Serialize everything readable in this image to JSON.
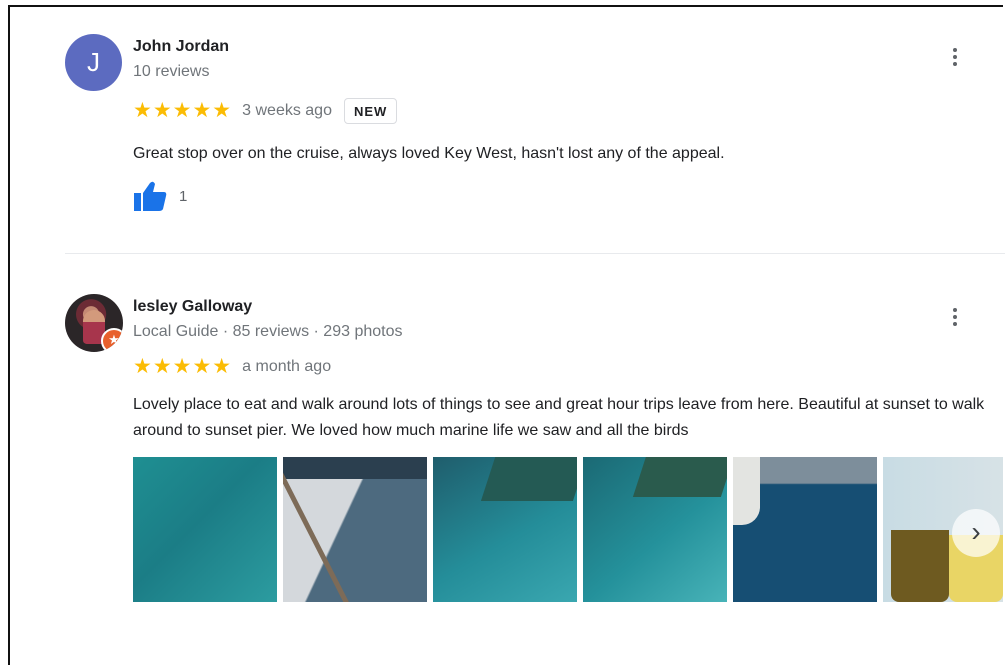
{
  "reviews": [
    {
      "avatar_letter": "J",
      "avatar_color": "#5c6bc0",
      "name": "John Jordan",
      "meta": "10 reviews",
      "stars": "★★★★★",
      "date": "3 weeks ago",
      "badge": "NEW",
      "text": "Great stop over on the cruise, always loved Key West, hasn't lost any of the appeal.",
      "likes": "1"
    },
    {
      "name": "lesley Galloway",
      "meta": "Local Guide · 85 reviews · 293 photos",
      "stars": "★★★★★",
      "date": "a month ago",
      "text": "Lovely place to eat and walk around lots of things to see and great hour trips leave from here.  Beautiful at sunset to walk around to sunset pier.  We loved how much marine life we saw and all the birds",
      "photo_count_visible": 6
    }
  ],
  "icons": {
    "more_menu": "more-vert-icon",
    "like": "thumbs-up-icon",
    "local_guide": "local-guide-star-icon",
    "next": "chevron-right-icon"
  },
  "colors": {
    "stars": "#fbbc04",
    "like_blue": "#1a73e8",
    "avatar": "#5c6bc0",
    "guide_badge": "#e8602c"
  },
  "navigation": {
    "next_glyph": "›"
  }
}
